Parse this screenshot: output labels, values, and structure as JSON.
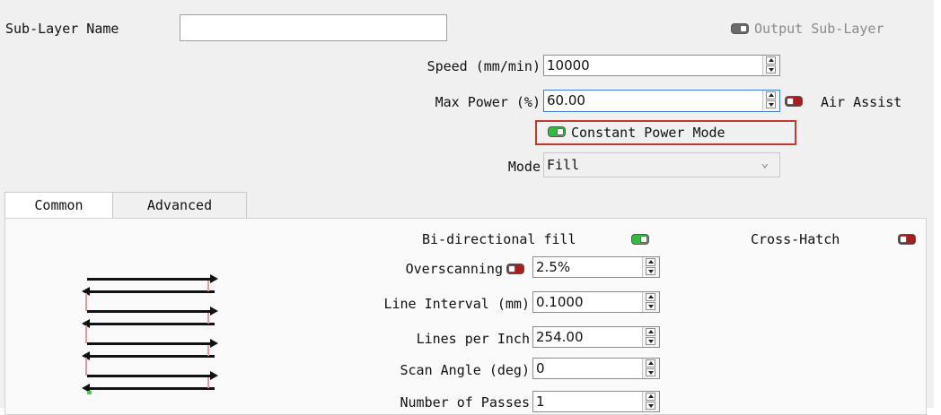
{
  "sublayer": {
    "name_label": "Sub-Layer Name",
    "name_value": "",
    "output_label": "Output Sub-Layer"
  },
  "speed": {
    "label": "Speed (mm/min)",
    "value": "10000"
  },
  "max_power": {
    "label": "Max Power (%)",
    "value": "60.00"
  },
  "air_assist": {
    "label": "Air Assist"
  },
  "constant_power": {
    "label": "Constant Power Mode"
  },
  "mode": {
    "label": "Mode",
    "value": "Fill"
  },
  "tabs": [
    {
      "label": "Common"
    },
    {
      "label": "Advanced"
    }
  ],
  "common": {
    "bidir_label": "Bi-directional fill",
    "crosshatch_label": "Cross-Hatch",
    "overscan": {
      "label": "Overscanning",
      "value": "2.5%"
    },
    "line_interval": {
      "label": "Line Interval (mm)",
      "value": "0.1000"
    },
    "lpi": {
      "label": "Lines per Inch",
      "value": "254.00"
    },
    "scan_angle": {
      "label": "Scan Angle (deg)",
      "value": "0"
    },
    "passes": {
      "label": "Number of Passes",
      "value": "1"
    }
  },
  "toggles": {
    "output_sublayer": "gray",
    "air_assist": "off",
    "constant_power": "on",
    "bidirectional": "on",
    "crosshatch": "off",
    "overscanning": "off"
  },
  "colors": {
    "on": "#2fbe3c",
    "off": "#a61e1e",
    "highlight_border": "#c0392b",
    "focus_border": "#3b7dd8"
  }
}
